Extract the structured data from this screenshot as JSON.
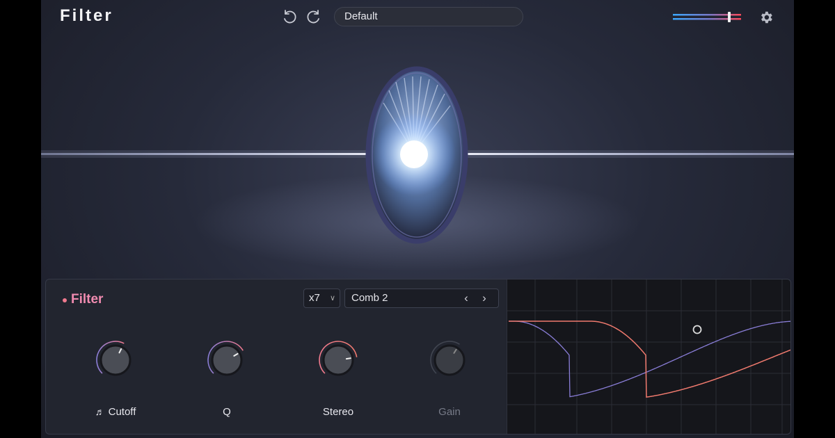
{
  "header": {
    "title": "Filter",
    "preset": "Default",
    "icons": [
      "undo-icon",
      "redo-icon",
      "io-meter",
      "gear-icon"
    ]
  },
  "module": {
    "name": "Filter",
    "voices": "x7",
    "mode": "Comb 2",
    "prev_glyph": "‹",
    "next_glyph": "›",
    "knobs": [
      {
        "label": "Cutoff",
        "icon": "music-note-icon",
        "value": 0.6
      },
      {
        "label": "Q",
        "value": 0.72
      },
      {
        "label": "Stereo",
        "value": 0.8
      },
      {
        "label": "Gain",
        "value": 0.62,
        "disabled": true
      }
    ]
  },
  "colors": {
    "accent_pink": "#f08bb0",
    "accent_red": "#f07a6e",
    "accent_purple": "#8a7ed8",
    "meter_blue": "#3aa8ff",
    "meter_red": "#ff4a5a"
  }
}
